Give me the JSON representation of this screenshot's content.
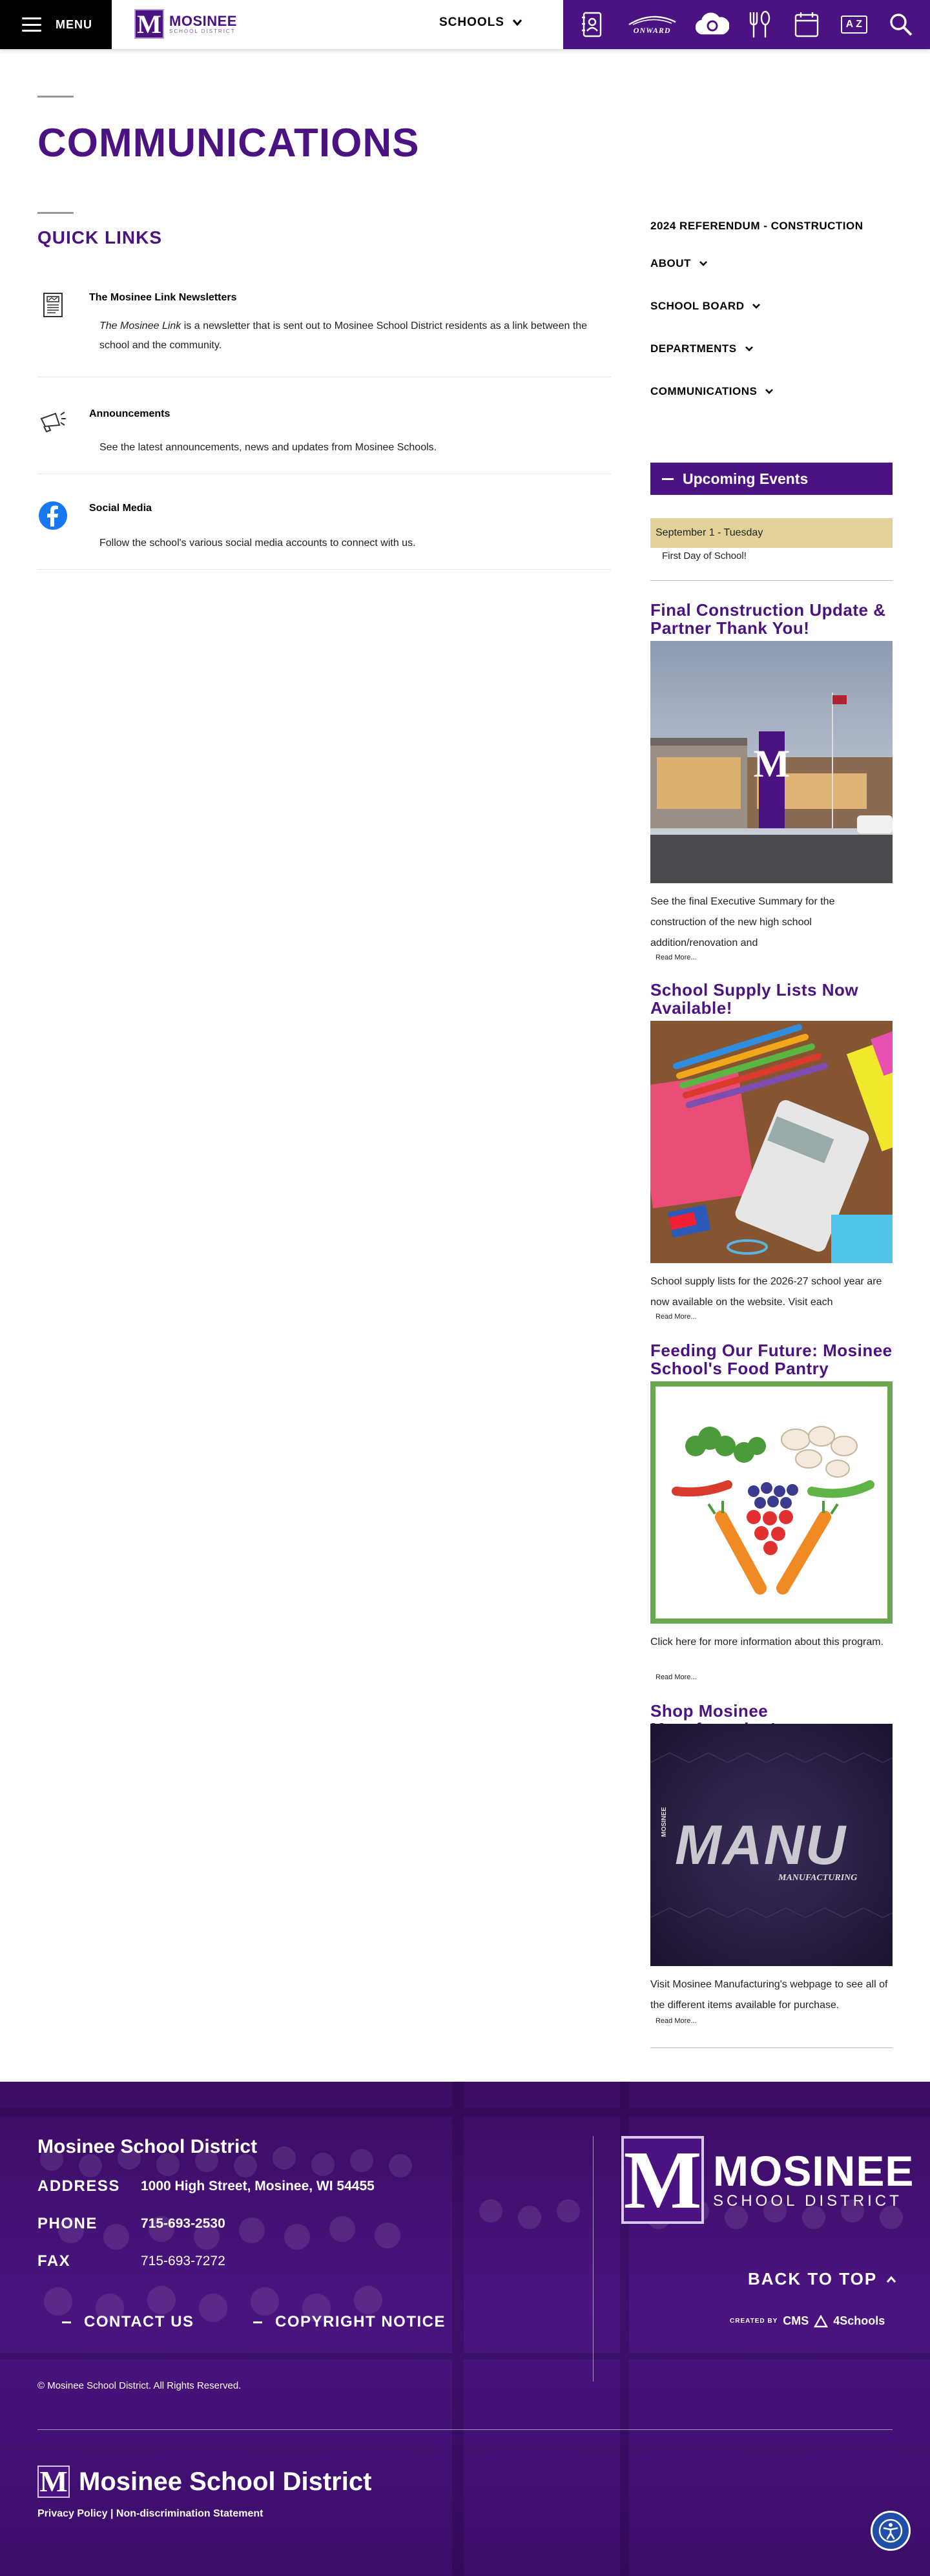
{
  "header": {
    "menu_label": "MENU",
    "logo_text": "MOSINEE",
    "logo_sub": "SCHOOL DISTRICT",
    "logo_letter": "M",
    "schools_label": "SCHOOLS",
    "quick_icons": [
      "directory-icon",
      "onward-logo-icon",
      "cloud-icon",
      "dining-icon",
      "calendar-icon",
      "a-to-z-icon",
      "search-icon"
    ],
    "onward_label": "ONWARD",
    "atoz_label": "A Z"
  },
  "main": {
    "page_title": "COMMUNICATIONS",
    "quick_links_title": "QUICK LINKS",
    "quick_links": [
      {
        "title": "The Mosinee Link Newsletters",
        "desc_italic": "The Mosinee Link",
        "desc": " is a newsletter that is sent out to Mosinee School District residents as a link between the school and the community."
      },
      {
        "title": "Announcements",
        "desc": "See the latest announcements, news and updates from Mosinee Schools."
      },
      {
        "title": "Social Media",
        "desc": "Follow the school's various social media accounts to connect with us."
      }
    ]
  },
  "sidebar": {
    "nav": [
      "2024 REFERENDUM - CONSTRUCTION",
      "ABOUT",
      "SCHOOL BOARD",
      "DEPARTMENTS",
      "COMMUNICATIONS"
    ],
    "upcoming_events_title": "Upcoming Events",
    "event": {
      "date": "September 1 - Tuesday",
      "title": "First Day of School!"
    },
    "news": [
      {
        "title": "Final Construction Update & Partner Thank You!",
        "desc": "See the final Executive Summary for the construction of the new high school addition/renovation and",
        "more": "Read More..."
      },
      {
        "title": "School Supply Lists Now Available!",
        "desc": "School supply lists for the 2026-27 school year are now available on the website.  Visit each",
        "more": "Read More..."
      },
      {
        "title": "Feeding Our Future: Mosinee School's Food Pantry",
        "desc": "Click here for more information about this program.",
        "more": "Read More..."
      },
      {
        "title": "Shop Mosinee Manufacturing!",
        "desc": "Visit Mosinee Manufacturing's webpage to see all of the different items available for purchase.",
        "more": "Read More..."
      }
    ],
    "manu_text": "MANU",
    "manu_side": "MOSINEE",
    "manu_sub": "MANUFACTURING"
  },
  "footer": {
    "district_name": "Mosinee School District",
    "address_label": "ADDRESS",
    "address": "1000 High Street, Mosinee, WI 54455",
    "phone_label": "PHONE",
    "phone": "715-693-2530",
    "fax_label": "FAX",
    "fax": "715-693-7272",
    "contact_label": "CONTACT US",
    "copyright_label": "COPYRIGHT NOTICE",
    "copyright_text": "© Mosinee School District. All Rights Reserved.",
    "logo_letter": "M",
    "logo_name": "MOSINEE",
    "logo_sub": "SCHOOL DISTRICT",
    "back_to_top": "BACK TO TOP",
    "created_by": "CREATED BY",
    "cms_brand": "CMS",
    "cms_brand_suffix": "4Schools",
    "bottom_name": "Mosinee School District",
    "privacy_policy": "Privacy Policy",
    "link_separator": "|",
    "nondiscrimination": "Non-discrimination Statement"
  },
  "colors": {
    "brand_purple": "#4b1281",
    "event_date_bg": "#e2d29a",
    "accessibility_blue": "#1f4fa8"
  }
}
